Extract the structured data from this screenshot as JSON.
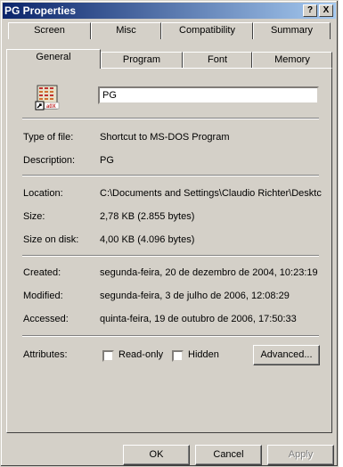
{
  "window": {
    "title": "PG Properties",
    "help_button": "?",
    "close_button": "X"
  },
  "tabs": {
    "row1": [
      "Screen",
      "Misc",
      "Compatibility",
      "Summary"
    ],
    "row2": [
      "General",
      "Program",
      "Font",
      "Memory"
    ],
    "active": "General"
  },
  "general": {
    "name_value": "PG",
    "icon": "ms-dos-shortcut-icon",
    "type_label": "Type of file:",
    "type_value": "Shortcut to MS-DOS Program",
    "description_label": "Description:",
    "description_value": "PG",
    "location_label": "Location:",
    "location_value": "C:\\Documents and Settings\\Claudio Richter\\Desktc",
    "size_label": "Size:",
    "size_value": "2,78 KB (2.855 bytes)",
    "size_on_disk_label": "Size on disk:",
    "size_on_disk_value": "4,00 KB (4.096 bytes)",
    "created_label": "Created:",
    "created_value": "segunda-feira, 20 de dezembro de 2004, 10:23:19",
    "modified_label": "Modified:",
    "modified_value": "segunda-feira, 3 de julho de 2006, 12:08:29",
    "accessed_label": "Accessed:",
    "accessed_value": "quinta-feira, 19 de outubro de 2006, 17:50:33",
    "attributes_label": "Attributes:",
    "readonly_label": "Read-only",
    "hidden_label": "Hidden",
    "advanced_button": "Advanced..."
  },
  "footer": {
    "ok": "OK",
    "cancel": "Cancel",
    "apply": "Apply"
  }
}
